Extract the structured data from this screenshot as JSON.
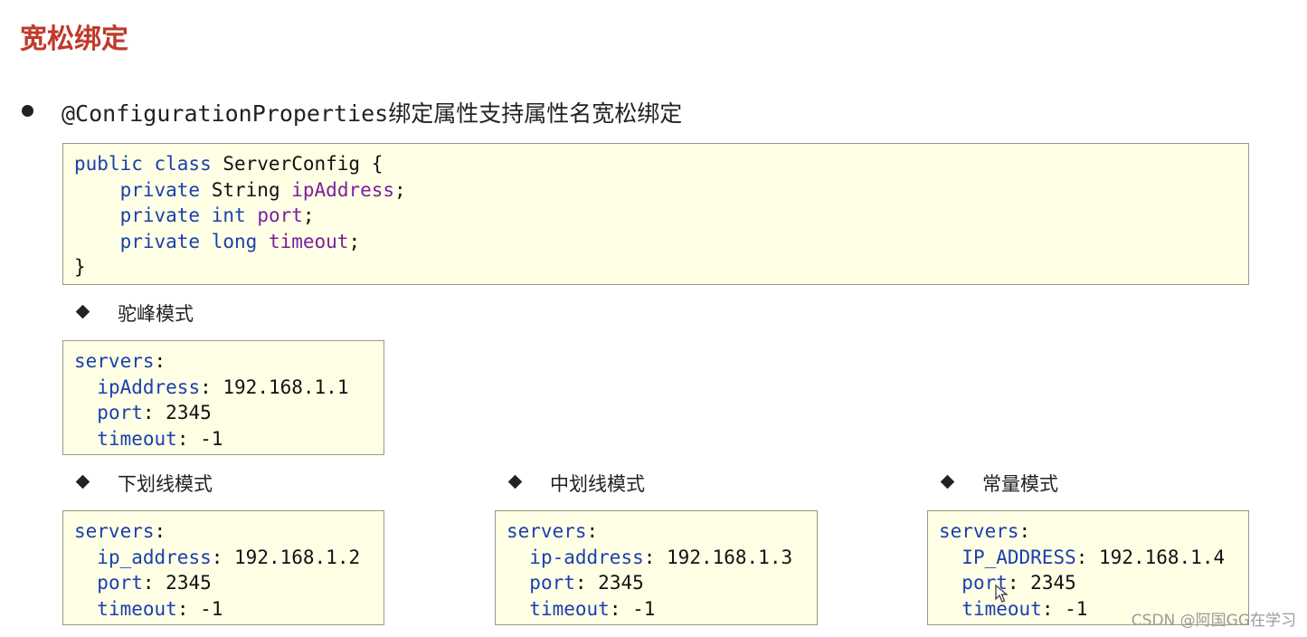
{
  "page": {
    "title": "宽松绑定",
    "bullet": "@ConfigurationProperties绑定属性支持属性名宽松绑定"
  },
  "java_code": {
    "line1": {
      "kw": "public class",
      "rest": " ServerConfig {"
    },
    "line2": {
      "kw": "private",
      "type": " String ",
      "field": "ipAddress",
      "end": ";"
    },
    "line3": {
      "kw": "private int",
      "field": "port",
      "end": ";"
    },
    "line4": {
      "kw": "private long",
      "field": "timeout",
      "end": ";"
    },
    "line5": "}"
  },
  "sections": [
    {
      "heading": "驼峰模式",
      "root": "servers",
      "ip_key": "ipAddress",
      "ip_val": "192.168.1.1",
      "port_key": "port",
      "port_val": "2345",
      "timeout_key": "timeout",
      "timeout_val": "-1"
    },
    {
      "heading": "下划线模式",
      "root": "servers",
      "ip_key": "ip_address",
      "ip_val": "192.168.1.2",
      "port_key": "port",
      "port_val": "2345",
      "timeout_key": "timeout",
      "timeout_val": "-1"
    },
    {
      "heading": "中划线模式",
      "root": "servers",
      "ip_key": "ip-address",
      "ip_val": "192.168.1.3",
      "port_key": "port",
      "port_val": "2345",
      "timeout_key": "timeout",
      "timeout_val": "-1"
    },
    {
      "heading": "常量模式",
      "root": "servers",
      "ip_key": "IP_ADDRESS",
      "ip_val": "192.168.1.4",
      "port_key": "port",
      "port_val": "2345",
      "timeout_key": "timeout",
      "timeout_val": "-1"
    }
  ],
  "watermark": "CSDN @阿国GG在学习",
  "colors": {
    "title": "#c0392b",
    "keyword": "#1a3fae",
    "field": "#7c1f9c",
    "box_bg": "#ffffe6"
  }
}
